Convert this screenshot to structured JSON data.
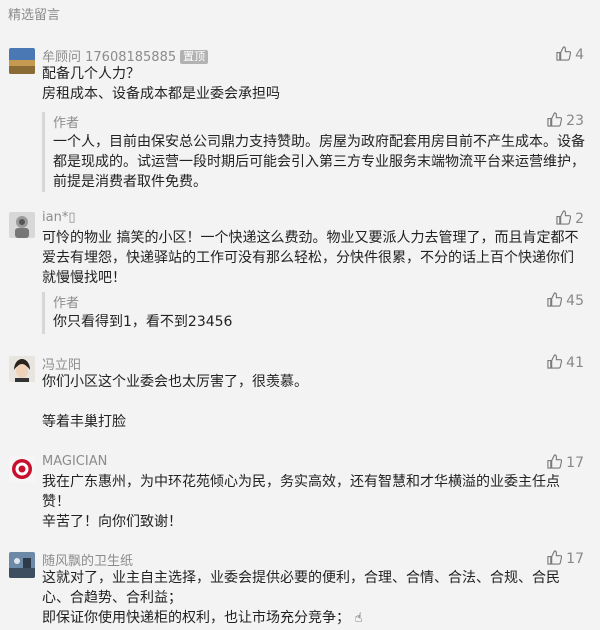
{
  "section_title": "精选留言",
  "comments": [
    {
      "nickname": "牟顾问 17608185885",
      "badge": "置顶",
      "likes": "4",
      "lines": [
        "配备几个人力？",
        "房租成本、设备成本都是业委会承担吗"
      ],
      "reply": {
        "author": "作者",
        "likes": "23",
        "lines": [
          "一个人，目前由保安总公司鼎力支持赞助。房屋为政府配套用房目前不产生成本。设备都是现成的。试运营一段时期后可能会引入第三方专业服务末端物流平台来运营维护，前提是消费者取件免费。"
        ]
      }
    },
    {
      "nickname": "ian*▯",
      "likes": "2",
      "lines": [
        "可怜的物业 搞笑的小区！一个快递这么费劲。物业又要派人力去管理了，而且肯定都不爱去有埋怨，快递驿站的工作可没有那么轻松，分快件很累，不分的话上百个快递你们就慢慢找吧！"
      ],
      "reply": {
        "author": "作者",
        "likes": "45",
        "lines": [
          "你只看得到1，看不到23456"
        ]
      }
    },
    {
      "nickname": "冯立阳",
      "likes": "41",
      "lines": [
        "你们小区这个业委会也太厉害了，很羡慕。",
        "",
        "等着丰巢打脸"
      ]
    },
    {
      "nickname": "MAGICIAN",
      "likes": "17",
      "lines": [
        "我在广东惠州，为中环花苑倾心为民，务实高效，还有智慧和才华横溢的业委主任点赞！",
        "辛苦了！向你们致谢！"
      ]
    },
    {
      "nickname": "随风飘的卫生纸",
      "likes": "17",
      "lines": [
        "这就对了，业主自主选择，业委会提供必要的便利，合理、合情、合法、合规、合民心、合趋势、合利益；",
        "即保证你使用快递柜的权利，也让市场充分竞争；"
      ],
      "trailing_icon": "pointing-hand-icon"
    }
  ],
  "colors": {
    "background": "#f3f3f3",
    "muted_text": "#8c8c8c",
    "body_text": "#222222",
    "reply_bar": "#d7d7d7"
  }
}
